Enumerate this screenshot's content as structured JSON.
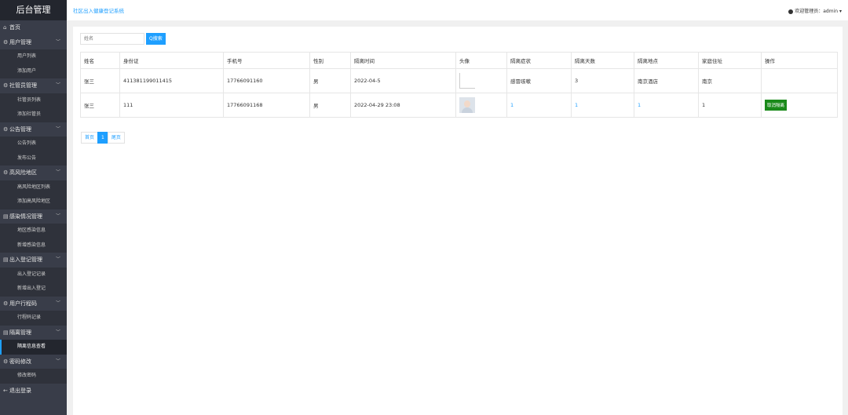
{
  "brand": "后台管理",
  "nav": {
    "home": "首页",
    "groups": [
      {
        "label": "用户管理",
        "items": [
          "用户列表",
          "添加用户"
        ]
      },
      {
        "label": "社管员管理",
        "items": [
          "社管员列表",
          "添加社管员"
        ]
      },
      {
        "label": "公告管理",
        "items": [
          "公告列表",
          "发布公告"
        ]
      },
      {
        "label": "高风险地区",
        "items": [
          "高风险地区列表",
          "添加高风险地区"
        ]
      },
      {
        "label": "感染情况管理",
        "items": [
          "地区感染信息",
          "新增感染信息"
        ]
      },
      {
        "label": "出入登记管理",
        "items": [
          "出入登记记录",
          "新增出入登记"
        ]
      },
      {
        "label": "用户行程码",
        "items": [
          "行程码记录"
        ]
      },
      {
        "label": "隔离管理",
        "items": [
          "隔离信息查看"
        ]
      },
      {
        "label": "密码修改",
        "items": [
          "修改密码"
        ]
      }
    ],
    "logout": "退出登录"
  },
  "header": {
    "breadcrumb": "社区出入健康登记系统",
    "user": "欢迎管理员：admin"
  },
  "search": {
    "placeholder": "姓名",
    "button": "Q搜索"
  },
  "table": {
    "headers": [
      "姓名",
      "身份证",
      "手机号",
      "性别",
      "隔离时间",
      "头像",
      "隔离症状",
      "隔离天数",
      "隔离地点",
      "家庭住址",
      "操作"
    ],
    "rows": [
      [
        "张三",
        "411381199011415",
        "17766091160",
        "男",
        "2022-04-5",
        "",
        "感冒咳嗽",
        "3",
        "南京酒店",
        "南京",
        ""
      ],
      [
        "张三",
        "111",
        "17766091168",
        "男",
        "2022-04-29 23:08",
        "",
        "1",
        "1",
        "1",
        "1",
        "取消隔离"
      ]
    ]
  },
  "pager": {
    "first": "首页",
    "current": "1",
    "last": "尾页"
  }
}
